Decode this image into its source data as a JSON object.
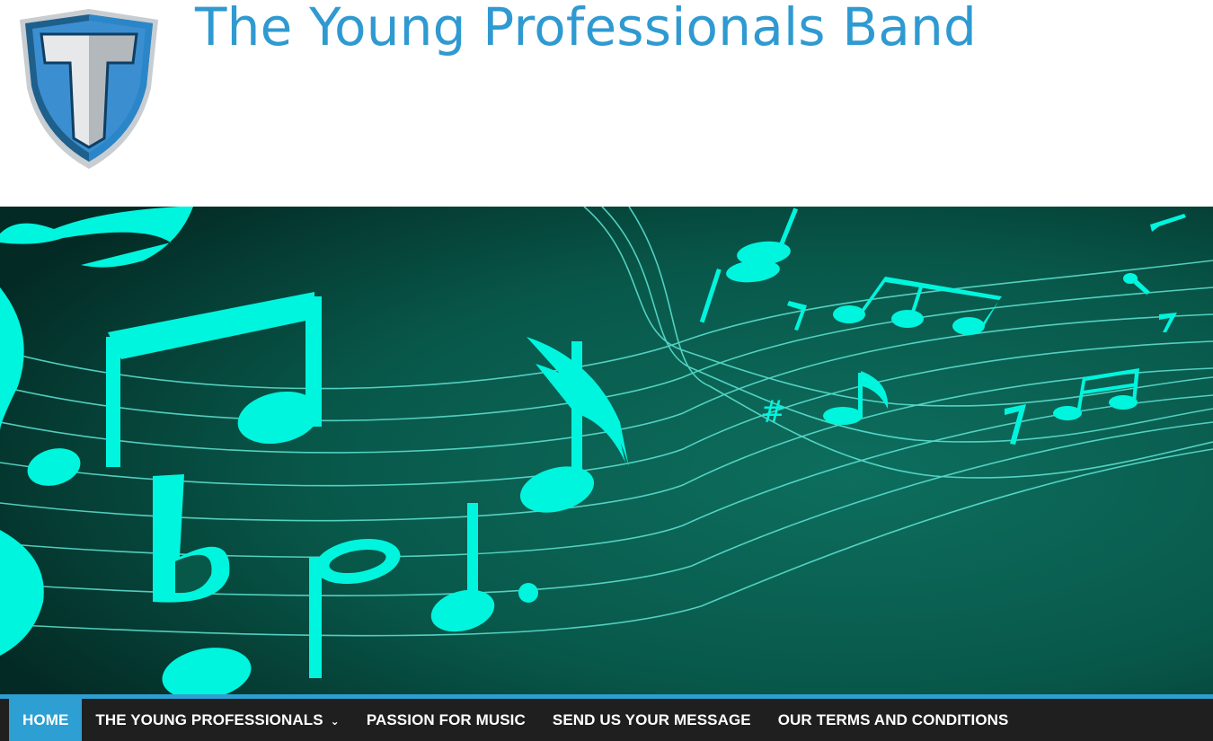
{
  "site": {
    "title": "The Young Professionals Band",
    "logo_icon": "shield-t-logo-icon"
  },
  "banner": {
    "image": "music-notes-staff-banner",
    "background_color": "#08584a",
    "note_color": "#00f5de"
  },
  "nav": {
    "accent_color": "#2e9fd3",
    "background_color": "#1f1f1f",
    "items": [
      {
        "label": "HOME",
        "active": true
      },
      {
        "label": "THE YOUNG PROFESSIONALS",
        "has_dropdown": true,
        "dropdown_icon": "chevron-down-icon"
      },
      {
        "label": "PASSION FOR MUSIC"
      },
      {
        "label": "SEND US YOUR MESSAGE"
      },
      {
        "label": "OUR TERMS AND CONDITIONS"
      }
    ]
  }
}
